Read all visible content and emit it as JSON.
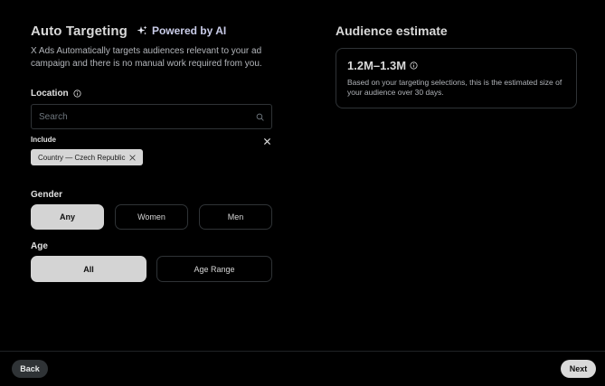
{
  "header": {
    "title": "Auto Targeting",
    "powered_label": "Powered by AI",
    "description": "X Ads Automatically targets audiences relevant to your ad campaign and there is no manual work required from you."
  },
  "location": {
    "label": "Location",
    "search_placeholder": "Search",
    "include_label": "Include",
    "chips": [
      {
        "label": "Country — Czech Republic"
      }
    ]
  },
  "gender": {
    "label": "Gender",
    "options": [
      {
        "label": "Any",
        "selected": true
      },
      {
        "label": "Women",
        "selected": false
      },
      {
        "label": "Men",
        "selected": false
      }
    ]
  },
  "age": {
    "label": "Age",
    "options": [
      {
        "label": "All",
        "selected": true
      },
      {
        "label": "Age Range",
        "selected": false
      }
    ]
  },
  "audience": {
    "title": "Audience estimate",
    "range": "1.2M–1.3M",
    "description": "Based on your targeting selections, this is the estimated size of your audience over 30 days."
  },
  "footer": {
    "back_label": "Back",
    "next_label": "Next"
  },
  "icons": {
    "sparkle": "sparkle-icon",
    "info": "info-icon",
    "search": "search-icon",
    "close": "close-icon"
  },
  "colors": {
    "background": "#000000",
    "selected_option": "#d4d4d4",
    "border": "#2f3336",
    "powered_text": "#c9cce8"
  }
}
